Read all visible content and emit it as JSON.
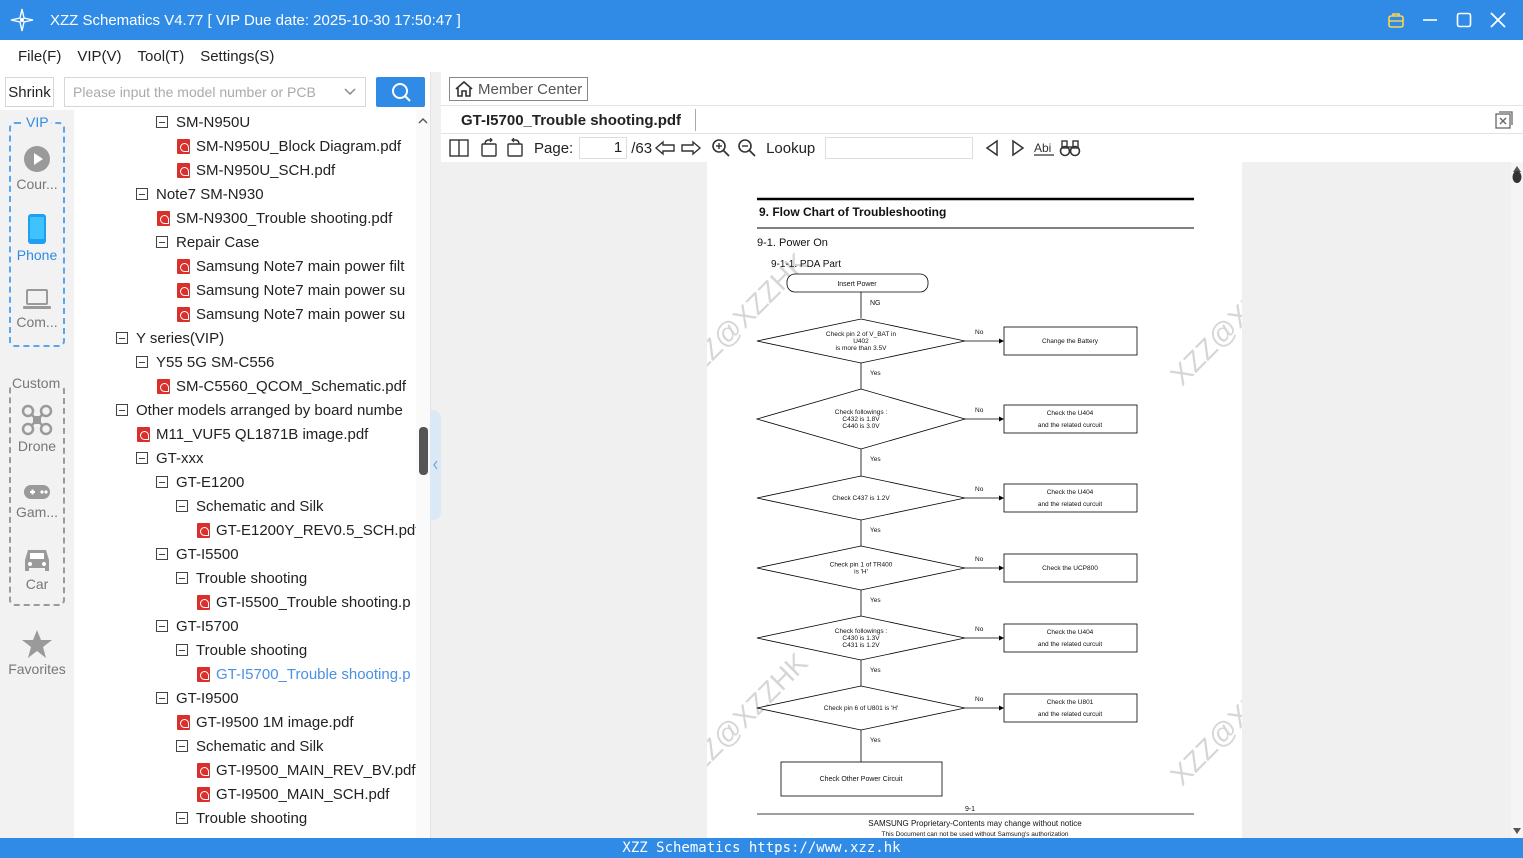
{
  "window": {
    "title": "XZZ Schematics V4.77 [ VIP Due date: 2025-10-30 17:50:47 ]",
    "accent": "#2f8be6"
  },
  "menu": [
    "File(F)",
    "VIP(V)",
    "Tool(T)",
    "Settings(S)"
  ],
  "toolbar": {
    "shrink_label": "Shrink",
    "search_placeholder": "Please input the model number or PCB"
  },
  "rail": {
    "vip_label": "VIP",
    "custom_label": "Custom",
    "items": [
      "Cour...",
      "Phone",
      "Com...",
      "Drone",
      "Gam...",
      "Car",
      "Favorites"
    ]
  },
  "tree": [
    "SM-N950U",
    "SM-N950U_Block Diagram.pdf",
    "SM-N950U_SCH.pdf",
    "Note7 SM-N930",
    "SM-N9300_Trouble shooting.pdf",
    "Repair Case",
    "Samsung Note7 main power filt",
    "Samsung Note7 main power su",
    "Samsung Note7 main power su",
    "Y series(VIP)",
    "Y55 5G SM-C556",
    "SM-C5560_QCOM_Schematic.pdf",
    "Other models arranged by board numbe",
    "M11_VUF5 QL1871B image.pdf",
    "GT-xxx",
    "GT-E1200",
    "Schematic and Silk",
    "GT-E1200Y_REV0.5_SCH.pdf",
    "GT-I5500",
    "Trouble shooting",
    "GT-I5500_Trouble shooting.p",
    "GT-I5700",
    "Trouble shooting",
    "GT-I5700_Trouble shooting.p",
    "GT-I9500",
    "GT-I9500 1M image.pdf",
    "Schematic and Silk",
    "GT-I9500_MAIN_REV_BV.pdf",
    "GT-I9500_MAIN_SCH.pdf",
    "Trouble shooting"
  ],
  "viewer": {
    "member_center": "Member Center",
    "tab_title": "GT-I5700_Trouble shooting.pdf",
    "page_label": "Page:",
    "page_current": "1",
    "page_total": "/63",
    "lookup_label": "Lookup"
  },
  "pdf": {
    "heading": "9. Flow Chart of Troubleshooting",
    "section": "9-1. Power On",
    "subsection": "9-1-1. PDA Part",
    "start": "Insert Power",
    "start_edge": "NG",
    "steps": [
      {
        "q1": "Check pin 2 of V_BAT in",
        "q2": "U402",
        "q3": "is more than 3.5V",
        "a1": "Change the Battery",
        "a2": ""
      },
      {
        "q1": "Check followings :",
        "q2": "C432 is 1.8V",
        "q3": "C440 is 3.0V",
        "a1": "Check the U404",
        "a2": "and the related curcuit"
      },
      {
        "q1": "",
        "q2": "Check C437 is 1.2V",
        "q3": "",
        "a1": "Check the U404",
        "a2": "and the related curcuit"
      },
      {
        "q1": "Check pin 1 of TR400",
        "q2": "is 'H'",
        "q3": "",
        "a1": "Check the UCP800",
        "a2": ""
      },
      {
        "q1": "Check followings :",
        "q2": "C430 is 1.3V",
        "q3": "C431 is 1.2V",
        "a1": "Check the U404",
        "a2": "and the related curcuit"
      },
      {
        "q1": "",
        "q2": "Check pin 6 of U801 is 'H'",
        "q3": "",
        "a1": "Check the U801",
        "a2": "and the related curcuit"
      }
    ],
    "no_label": "No",
    "yes_label": "Yes",
    "end": "Check Other Power Circuit",
    "page_no": "9-1",
    "footer1": "SAMSUNG Proprietary-Contents may change without notice",
    "footer2": "This Document can not be used without Samsung's authorization",
    "watermark": "XZZ@XZZHK"
  },
  "footer": "XZZ Schematics https://www.xzz.hk"
}
